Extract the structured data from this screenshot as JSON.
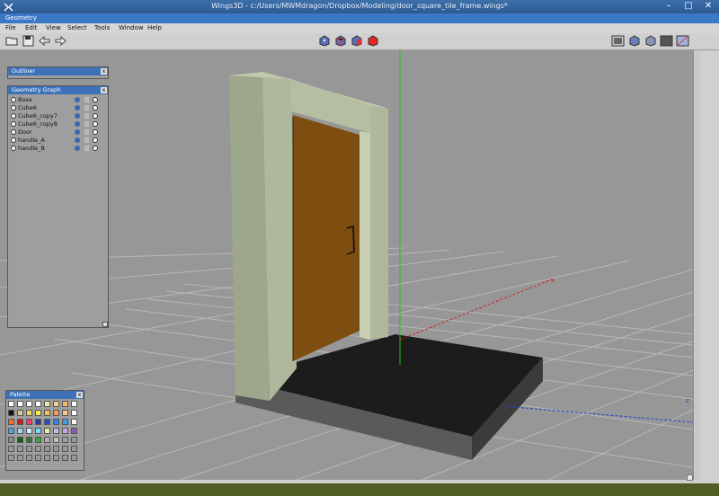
{
  "window": {
    "title": "Wings3D - c:/Users/MWMdragon/Dropbox/Modeling/door_square_tile_frame.wings*",
    "minimize_glyph": "–",
    "maximize_glyph": "□",
    "close_glyph": "✕"
  },
  "doc_bar": {
    "label": "Geometry"
  },
  "menu": {
    "items": [
      "File",
      "Edit",
      "View",
      "Select",
      "Tools",
      "Window",
      "Help"
    ]
  },
  "toolbar": {
    "left_icons": [
      "open-folder-icon",
      "save-disk-icon",
      "undo-arrow-icon",
      "redo-arrow-icon"
    ],
    "mode_icons": [
      "vertex-mode-icon",
      "edge-mode-icon",
      "face-mode-icon",
      "body-mode-icon"
    ],
    "right_icons": [
      "smooth-preview-icon",
      "workmode-icon",
      "wireframe-icon",
      "ground-plane-icon",
      "perspective-icon"
    ]
  },
  "outliner": {
    "title": "Outliner",
    "close": "x"
  },
  "geometry_graph": {
    "title": "Geometry Graph",
    "close": "x",
    "objects": [
      "Base",
      "Cube6",
      "Cube6_copy7",
      "Cube6_copy8",
      "Door",
      "handle_A",
      "handle_B"
    ]
  },
  "palette": {
    "title": "Palette",
    "close": "x",
    "colors": [
      "#ffffff",
      "#ffffff",
      "#ffffff",
      "#ffffff",
      "#f3e7b0",
      "#f5c98a",
      "#f3b56a",
      "#ffffff",
      "#111111",
      "#d8c88f",
      "#f4d35a",
      "#f6e84a",
      "#f2c060",
      "#f09a60",
      "#f7c98a",
      "#ffffff",
      "#f2712d",
      "#c81e1e",
      "#ff3b6a",
      "#2b3e9a",
      "#2b4fc0",
      "#3b7fe0",
      "#3ca0e8",
      "#ffffff",
      "#4aa3d9",
      "#a4d8f2",
      "#c8ecff",
      "#7bd8ff",
      "#d4f2a0",
      "#c5b8e8",
      "#d0a0f0",
      "#8a5ab8",
      "#8a8a8a",
      "#1a5a1a",
      "#2e7a2e",
      "#3ca63c",
      "#b0b0b0",
      "#c0c0c0",
      "#a0a0a0",
      "#9a9a9a"
    ]
  },
  "scene": {
    "frame_color": "#9da78c",
    "door_color": "#7e4e10",
    "base_color": "#1c1c1c",
    "axis_x_color": "#d02020",
    "axis_y_color": "#20c020",
    "axis_z_color": "#2040d0",
    "axis_x_label": "x",
    "axis_z_label": "z"
  }
}
